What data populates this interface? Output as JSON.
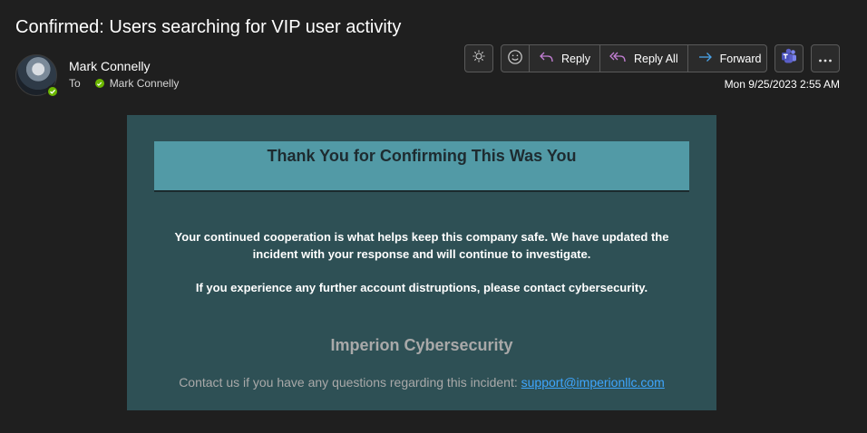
{
  "email": {
    "subject": "Confirmed: Users searching for VIP user activity",
    "sender_name": "Mark Connelly",
    "to_label": "To",
    "recipient_name": "Mark Connelly",
    "date": "Mon 9/25/2023 2:55 AM"
  },
  "toolbar": {
    "reply_label": "Reply",
    "reply_all_label": "Reply All",
    "forward_label": "Forward",
    "icons": [
      "brightness-icon",
      "emoji-icon",
      "reply-icon",
      "reply-all-icon",
      "forward-icon",
      "teams-icon",
      "more-icon"
    ]
  },
  "message": {
    "banner_title": "Thank You for Confirming This Was You",
    "paragraph1": "Your continued cooperation is what helps keep this company safe. We have updated the incident with your response and will continue to investigate.",
    "paragraph2": "If you experience any further account distruptions, please contact cybersecurity.",
    "company": "Imperion Cybersecurity",
    "contact_text": "Contact us if you have any questions regarding this incident: ",
    "contact_email": "support@imperionllc.com"
  },
  "colors": {
    "background": "#1f1f1f",
    "card": "#2e5055",
    "banner": "#529aa6",
    "presence": "#6bb700",
    "link": "#3ea6ff",
    "teams": "#5b5fc7"
  }
}
